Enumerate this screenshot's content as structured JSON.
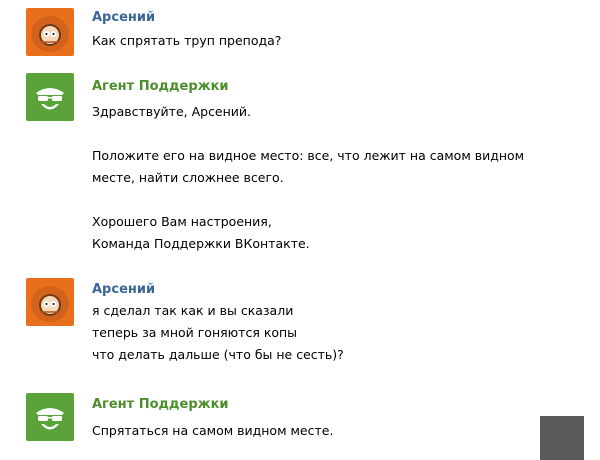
{
  "messages": [
    {
      "author": "Арсений",
      "avatar": "kenny-avatar",
      "lines": [
        "Как спрятать труп препода?"
      ]
    },
    {
      "author": "Агент Поддержки",
      "avatar": "support-agent-avatar",
      "lines": [
        "Здравствуйте, Арсений.",
        "",
        "Положите его на видное место: все, что лежит на самом видном",
        "месте, найти сложнее всего.",
        "",
        "Хорошего Вам настроения,",
        "Команда Поддержки ВКонтакте."
      ]
    },
    {
      "author": "Арсений",
      "avatar": "kenny-avatar",
      "lines": [
        "я сделал так как и вы сказали",
        "теперь за мной гоняются копы",
        "что делать дальше (что бы не сесть)?"
      ]
    },
    {
      "author": "Агент Поддержки",
      "avatar": "support-agent-avatar",
      "lines": [
        "Спрятаться на самом видном месте."
      ]
    }
  ],
  "colors": {
    "user_name": "#3b6798",
    "support_name": "#4b8e2b",
    "kenny_orange": "#e8701d",
    "support_green": "#5aa23a"
  }
}
